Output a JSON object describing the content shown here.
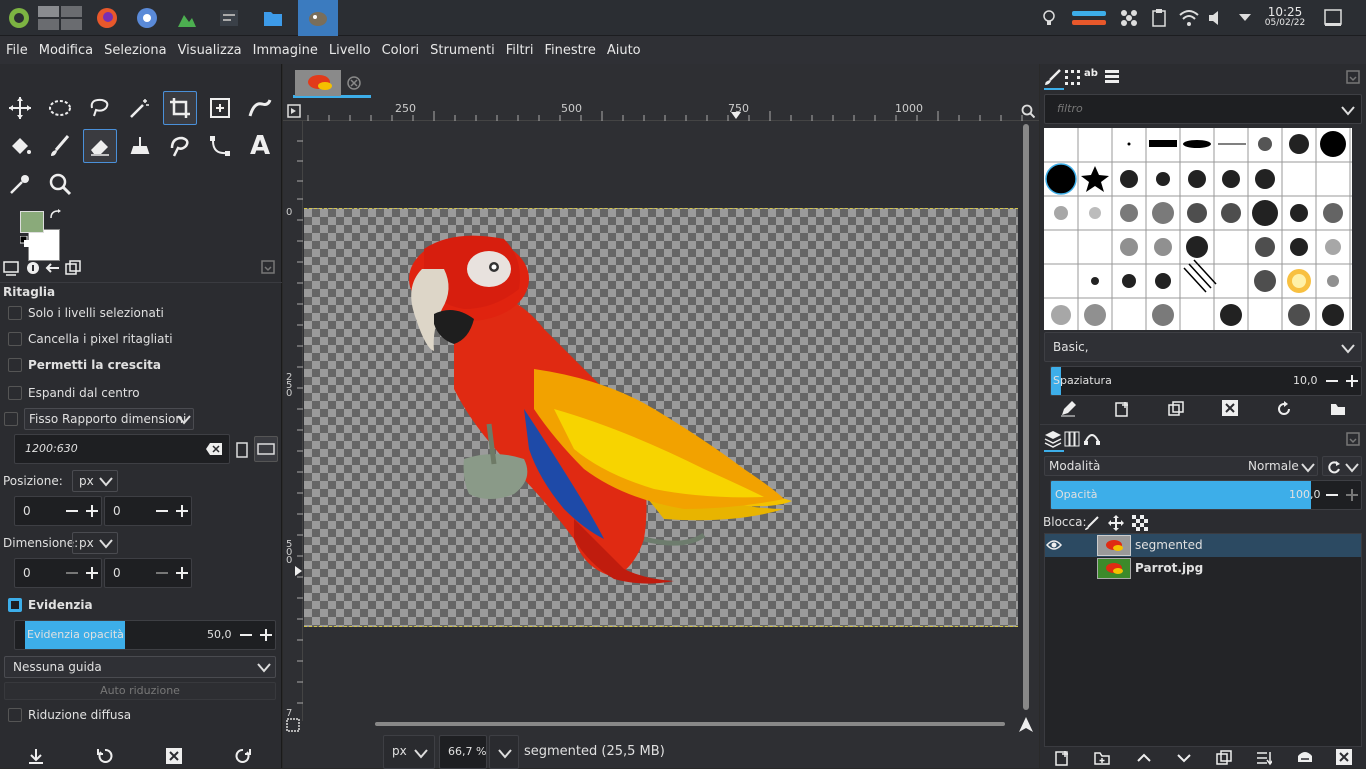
{
  "taskbar": {
    "clock_time": "10:25",
    "clock_date": "05/02/22"
  },
  "menu": [
    "File",
    "Modifica",
    "Seleziona",
    "Visualizza",
    "Immagine",
    "Livello",
    "Colori",
    "Strumenti",
    "Filtri",
    "Finestre",
    "Aiuto"
  ],
  "tool_options": {
    "title": "Ritaglia",
    "only_selected_layers": "Solo i livelli selezionati",
    "delete_cropped": "Cancella i pixel ritagliati",
    "allow_growing": "Permetti la crescita",
    "expand_center": "Espandi dal centro",
    "fixed_ratio": "Fisso Rapporto dimensioni",
    "ratio_value": "1200:630",
    "position_label": "Posizione:",
    "position_unit": "px",
    "position_x": "0",
    "position_y": "0",
    "size_label": "Dimensione:",
    "size_unit": "px",
    "size_w": "0",
    "size_h": "0",
    "highlight": "Evidenzia",
    "highlight_opacity_label": "Evidenzia opacità",
    "highlight_opacity_value": "50,0",
    "highlight_opacity": 0.5,
    "guides": "Nessuna guida",
    "auto_shrink": "Auto riduzione",
    "shrink_merged": "Riduzione diffusa"
  },
  "canvas": {
    "ruler_h": [
      "250",
      "500",
      "750",
      "1000"
    ],
    "ruler_v": [
      "0",
      "2\n5\n0",
      "5\n0\n0",
      "7"
    ],
    "status_unit": "px",
    "zoom": "66,7 %",
    "status_text": "segmented (25,5 MB)"
  },
  "brushes": {
    "filter_placeholder": "filtro",
    "preset": "Basic,",
    "spacing_label": "Spaziatura",
    "spacing_value": "10,0",
    "spacing": 0.1
  },
  "layers": {
    "mode_label": "Modalità",
    "mode_value": "Normale",
    "opacity_label": "Opacità",
    "opacity_value": "100,0",
    "opacity": 1.0,
    "lock_label": "Blocca:",
    "items": [
      {
        "name": "segmented",
        "selected": true,
        "visible": true
      },
      {
        "name": "Parrot.jpg",
        "selected": false,
        "visible": false
      }
    ]
  },
  "colors": {
    "fg": "#8aaa7a",
    "bg": "#ffffff",
    "accent": "#3daee9"
  }
}
